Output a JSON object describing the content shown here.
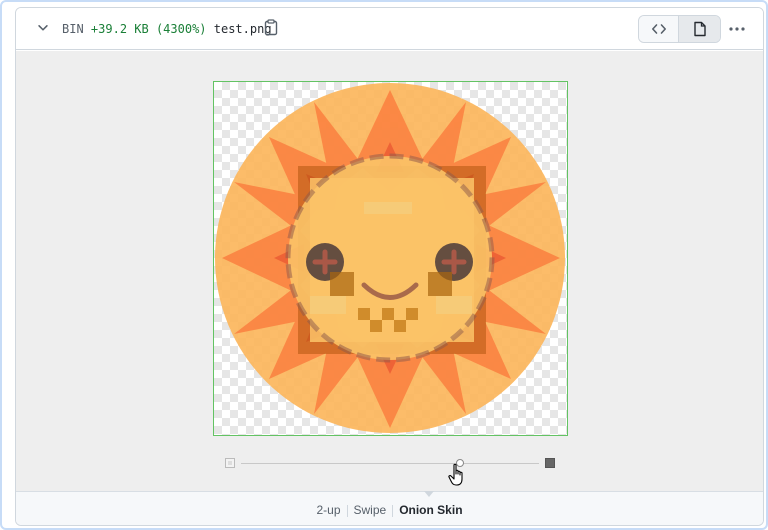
{
  "file_header": {
    "type_label": "BIN",
    "size_change": "+39.2 KB (4300%)",
    "filename": "test.png"
  },
  "view_toggle": {
    "source_icon": "code-icon",
    "rich_icon": "file-icon",
    "selected": "rich"
  },
  "more_icon": "kebab-horizontal-icon",
  "image_diff": {
    "image_icon": "sun-face-image",
    "opacity_slider": 0.7,
    "accent_border": "#63c363"
  },
  "modes": {
    "two_up": "2-up",
    "swipe": "Swipe",
    "onion_skin": "Onion Skin",
    "active": "Onion Skin"
  },
  "colors": {
    "added_text": "#1a7f37",
    "sun_orange": "#fcb65c",
    "petal": "#fb7a3c"
  }
}
